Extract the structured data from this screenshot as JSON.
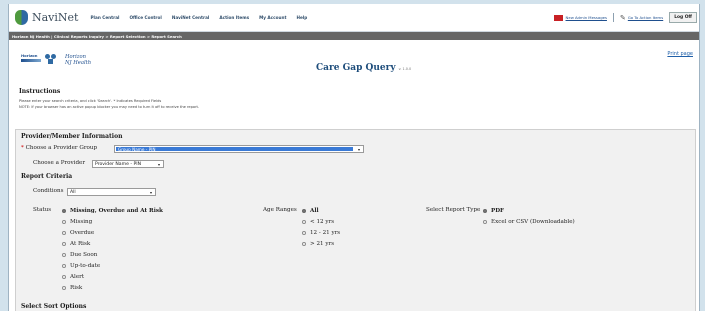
{
  "app": {
    "logo_text": "NaviNet"
  },
  "nav": {
    "items": [
      "Plan Central",
      "Office Control",
      "NaviNet Central",
      "Action Items",
      "My Account",
      "Help"
    ]
  },
  "top_right": {
    "messages": "New Admin Messages",
    "action_items": "Go To Action Items",
    "logoff": "Log Off",
    "messages_icon": "mail-icon",
    "pen_icon": "pen-icon"
  },
  "breadcrumb": "Horizon NJ Health  |  Clinical Reports Inquiry > Report Selection > Report Search",
  "brand": {
    "bcbs_text": "BlueCross BlueShield",
    "plan_name_line1": "Horizon",
    "plan_name_line2": "NJ Health",
    "sub": "Horizon Healthcare of NJ"
  },
  "page": {
    "title": "Care Gap Query",
    "version": "v. 1.0.0",
    "print_label": "Print page"
  },
  "instructions": {
    "heading": "Instructions",
    "line1": "Please enter your search criteria, and click 'Search'.  * Indicates Required Fields",
    "line2": "NOTE: If your browser has an active popup blocker you may need to turn it off to receive the report."
  },
  "provider_info": {
    "heading": "Provider/Member Information",
    "group_label": "Choose a Provider Group",
    "group_value": "Group Name - PIN",
    "provider_label": "Choose a Provider",
    "provider_value": "Provider Name - PIN"
  },
  "report_criteria": {
    "heading": "Report Criteria",
    "conditions_label": "Conditions",
    "conditions_value": "All",
    "status_label": "Status",
    "status_options": [
      "Missing, Overdue and At Risk",
      "Missing",
      "Overdue",
      "At Risk",
      "Due Soon",
      "Up-to-date",
      "Alert",
      "Risk"
    ],
    "age_label": "Age Ranges",
    "age_options": [
      "All",
      "< 12 yrs",
      "12 - 21 yrs",
      "> 21 yrs"
    ],
    "type_label": "Select Report Type",
    "type_options": [
      "PDF",
      "Excel or CSV (Downloadable)"
    ]
  },
  "sort": {
    "heading": "Select Sort Options"
  }
}
